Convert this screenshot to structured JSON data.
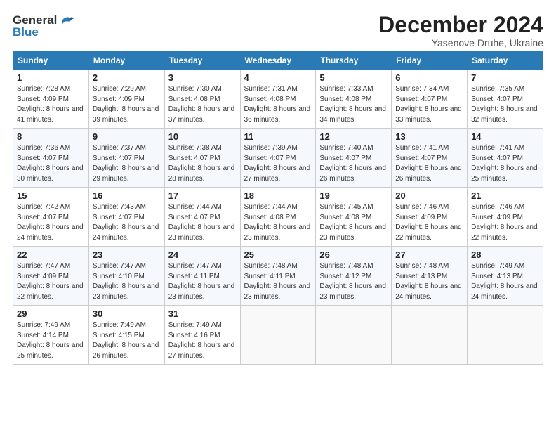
{
  "header": {
    "logo_general": "General",
    "logo_blue": "Blue",
    "month_title": "December 2024",
    "subtitle": "Yasenove Druhe, Ukraine"
  },
  "weekdays": [
    "Sunday",
    "Monday",
    "Tuesday",
    "Wednesday",
    "Thursday",
    "Friday",
    "Saturday"
  ],
  "weeks": [
    [
      {
        "day": "1",
        "sunrise": "Sunrise: 7:28 AM",
        "sunset": "Sunset: 4:09 PM",
        "daylight": "Daylight: 8 hours and 41 minutes."
      },
      {
        "day": "2",
        "sunrise": "Sunrise: 7:29 AM",
        "sunset": "Sunset: 4:09 PM",
        "daylight": "Daylight: 8 hours and 39 minutes."
      },
      {
        "day": "3",
        "sunrise": "Sunrise: 7:30 AM",
        "sunset": "Sunset: 4:08 PM",
        "daylight": "Daylight: 8 hours and 37 minutes."
      },
      {
        "day": "4",
        "sunrise": "Sunrise: 7:31 AM",
        "sunset": "Sunset: 4:08 PM",
        "daylight": "Daylight: 8 hours and 36 minutes."
      },
      {
        "day": "5",
        "sunrise": "Sunrise: 7:33 AM",
        "sunset": "Sunset: 4:08 PM",
        "daylight": "Daylight: 8 hours and 34 minutes."
      },
      {
        "day": "6",
        "sunrise": "Sunrise: 7:34 AM",
        "sunset": "Sunset: 4:07 PM",
        "daylight": "Daylight: 8 hours and 33 minutes."
      },
      {
        "day": "7",
        "sunrise": "Sunrise: 7:35 AM",
        "sunset": "Sunset: 4:07 PM",
        "daylight": "Daylight: 8 hours and 32 minutes."
      }
    ],
    [
      {
        "day": "8",
        "sunrise": "Sunrise: 7:36 AM",
        "sunset": "Sunset: 4:07 PM",
        "daylight": "Daylight: 8 hours and 30 minutes."
      },
      {
        "day": "9",
        "sunrise": "Sunrise: 7:37 AM",
        "sunset": "Sunset: 4:07 PM",
        "daylight": "Daylight: 8 hours and 29 minutes."
      },
      {
        "day": "10",
        "sunrise": "Sunrise: 7:38 AM",
        "sunset": "Sunset: 4:07 PM",
        "daylight": "Daylight: 8 hours and 28 minutes."
      },
      {
        "day": "11",
        "sunrise": "Sunrise: 7:39 AM",
        "sunset": "Sunset: 4:07 PM",
        "daylight": "Daylight: 8 hours and 27 minutes."
      },
      {
        "day": "12",
        "sunrise": "Sunrise: 7:40 AM",
        "sunset": "Sunset: 4:07 PM",
        "daylight": "Daylight: 8 hours and 26 minutes."
      },
      {
        "day": "13",
        "sunrise": "Sunrise: 7:41 AM",
        "sunset": "Sunset: 4:07 PM",
        "daylight": "Daylight: 8 hours and 26 minutes."
      },
      {
        "day": "14",
        "sunrise": "Sunrise: 7:41 AM",
        "sunset": "Sunset: 4:07 PM",
        "daylight": "Daylight: 8 hours and 25 minutes."
      }
    ],
    [
      {
        "day": "15",
        "sunrise": "Sunrise: 7:42 AM",
        "sunset": "Sunset: 4:07 PM",
        "daylight": "Daylight: 8 hours and 24 minutes."
      },
      {
        "day": "16",
        "sunrise": "Sunrise: 7:43 AM",
        "sunset": "Sunset: 4:07 PM",
        "daylight": "Daylight: 8 hours and 24 minutes."
      },
      {
        "day": "17",
        "sunrise": "Sunrise: 7:44 AM",
        "sunset": "Sunset: 4:07 PM",
        "daylight": "Daylight: 8 hours and 23 minutes."
      },
      {
        "day": "18",
        "sunrise": "Sunrise: 7:44 AM",
        "sunset": "Sunset: 4:08 PM",
        "daylight": "Daylight: 8 hours and 23 minutes."
      },
      {
        "day": "19",
        "sunrise": "Sunrise: 7:45 AM",
        "sunset": "Sunset: 4:08 PM",
        "daylight": "Daylight: 8 hours and 23 minutes."
      },
      {
        "day": "20",
        "sunrise": "Sunrise: 7:46 AM",
        "sunset": "Sunset: 4:09 PM",
        "daylight": "Daylight: 8 hours and 22 minutes."
      },
      {
        "day": "21",
        "sunrise": "Sunrise: 7:46 AM",
        "sunset": "Sunset: 4:09 PM",
        "daylight": "Daylight: 8 hours and 22 minutes."
      }
    ],
    [
      {
        "day": "22",
        "sunrise": "Sunrise: 7:47 AM",
        "sunset": "Sunset: 4:09 PM",
        "daylight": "Daylight: 8 hours and 22 minutes."
      },
      {
        "day": "23",
        "sunrise": "Sunrise: 7:47 AM",
        "sunset": "Sunset: 4:10 PM",
        "daylight": "Daylight: 8 hours and 23 minutes."
      },
      {
        "day": "24",
        "sunrise": "Sunrise: 7:47 AM",
        "sunset": "Sunset: 4:11 PM",
        "daylight": "Daylight: 8 hours and 23 minutes."
      },
      {
        "day": "25",
        "sunrise": "Sunrise: 7:48 AM",
        "sunset": "Sunset: 4:11 PM",
        "daylight": "Daylight: 8 hours and 23 minutes."
      },
      {
        "day": "26",
        "sunrise": "Sunrise: 7:48 AM",
        "sunset": "Sunset: 4:12 PM",
        "daylight": "Daylight: 8 hours and 23 minutes."
      },
      {
        "day": "27",
        "sunrise": "Sunrise: 7:48 AM",
        "sunset": "Sunset: 4:13 PM",
        "daylight": "Daylight: 8 hours and 24 minutes."
      },
      {
        "day": "28",
        "sunrise": "Sunrise: 7:49 AM",
        "sunset": "Sunset: 4:13 PM",
        "daylight": "Daylight: 8 hours and 24 minutes."
      }
    ],
    [
      {
        "day": "29",
        "sunrise": "Sunrise: 7:49 AM",
        "sunset": "Sunset: 4:14 PM",
        "daylight": "Daylight: 8 hours and 25 minutes."
      },
      {
        "day": "30",
        "sunrise": "Sunrise: 7:49 AM",
        "sunset": "Sunset: 4:15 PM",
        "daylight": "Daylight: 8 hours and 26 minutes."
      },
      {
        "day": "31",
        "sunrise": "Sunrise: 7:49 AM",
        "sunset": "Sunset: 4:16 PM",
        "daylight": "Daylight: 8 hours and 27 minutes."
      },
      null,
      null,
      null,
      null
    ]
  ]
}
